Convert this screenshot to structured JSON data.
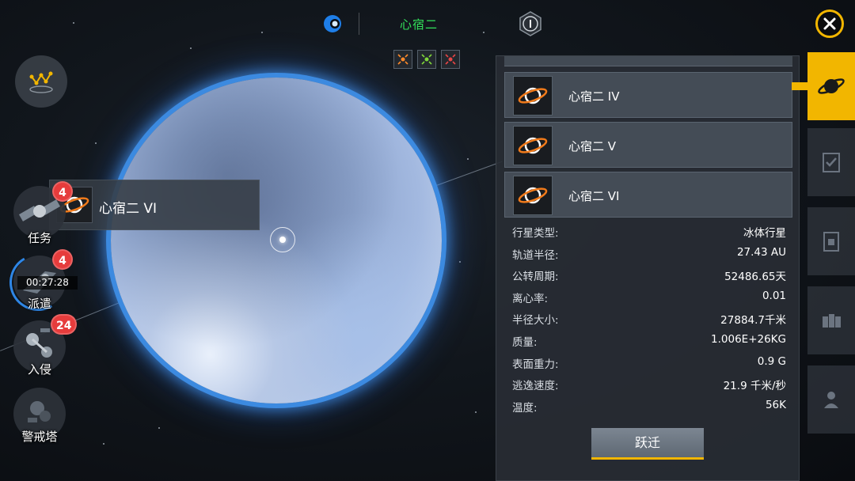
{
  "header": {
    "system_name": "心宿二"
  },
  "left_menu": {
    "missions": {
      "label": "任务",
      "badge": "4"
    },
    "dispatch": {
      "label": "派遣",
      "badge": "4",
      "timer": "00:27:28"
    },
    "invasion": {
      "label": "入侵",
      "badge": "24"
    },
    "watchtower": {
      "label": "警戒塔"
    }
  },
  "selected_planet": {
    "name": "心宿二 VI"
  },
  "planet_list": [
    {
      "name": "心宿二 IV"
    },
    {
      "name": "心宿二 V"
    },
    {
      "name": "心宿二 VI"
    }
  ],
  "details": [
    {
      "key": "行星类型:",
      "value": "冰体行星"
    },
    {
      "key": "轨道半径:",
      "value": "27.43 AU"
    },
    {
      "key": "公转周期:",
      "value": "52486.65天"
    },
    {
      "key": "离心率:",
      "value": "0.01"
    },
    {
      "key": "半径大小:",
      "value": "27884.7千米"
    },
    {
      "key": "质量:",
      "value": "1.006E+26KG"
    },
    {
      "key": "表面重力:",
      "value": "0.9 G"
    },
    {
      "key": "逃逸速度:",
      "value": "21.9 千米/秒"
    },
    {
      "key": "温度:",
      "value": "56K"
    }
  ],
  "actions": {
    "jump_label": "跃迁"
  },
  "colors": {
    "accent": "#f2b600",
    "system_title": "#33e05a",
    "badge": "#e63c3c",
    "planet_glow": "#3c8ae0"
  }
}
